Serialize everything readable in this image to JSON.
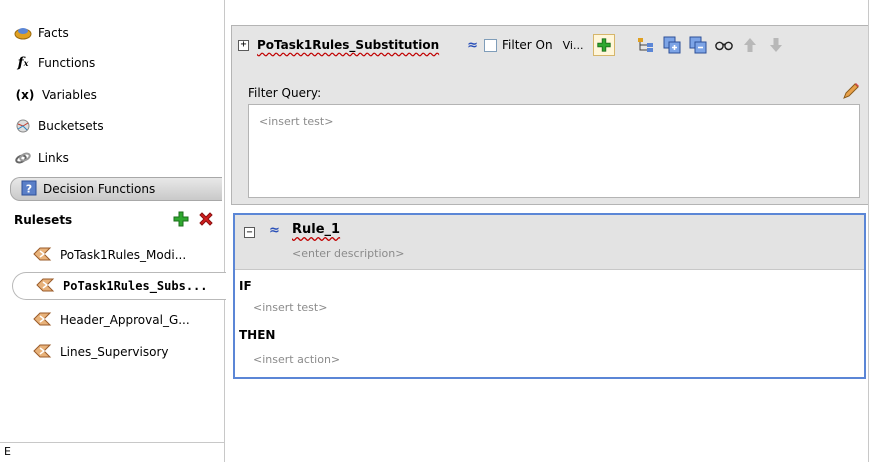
{
  "sidebar": {
    "items": [
      {
        "label": "Facts",
        "icon": "facts-icon"
      },
      {
        "label": "Functions",
        "icon": "functions-icon"
      },
      {
        "label": "Variables",
        "icon": "variables-icon"
      },
      {
        "label": "Bucketsets",
        "icon": "bucketsets-icon"
      },
      {
        "label": "Links",
        "icon": "links-icon"
      }
    ],
    "decision_functions": {
      "label": "Decision Functions",
      "icon": "decision-functions-icon"
    },
    "rulesets": {
      "header": "Rulesets",
      "items": [
        {
          "label": "PoTask1Rules_Modi...",
          "selected": false
        },
        {
          "label": "PoTask1Rules_Subs...",
          "selected": true
        },
        {
          "label": "Header_Approval_G...",
          "selected": false
        },
        {
          "label": "Lines_Supervisory",
          "selected": false
        }
      ]
    },
    "bottom_glyph": "E"
  },
  "ruleset": {
    "expand_glyph": "+",
    "name": "PoTask1Rules_Substitution",
    "collapse_glyph": "≈",
    "filter_on_label": "Filter On",
    "view_label": "Vi...",
    "filter_query_label": "Filter Query:",
    "filter_query_placeholder": "<insert test>"
  },
  "rule": {
    "collapse_glyph": "−",
    "chevron_glyph": "≈",
    "name": "Rule_1",
    "description_placeholder": "<enter description>",
    "if_label": "IF",
    "if_placeholder": "<insert test>",
    "then_label": "THEN",
    "then_placeholder": "<insert action>"
  },
  "colors": {
    "accent_blue": "#5b86d6",
    "add_green": "#2fa82f",
    "delete_red": "#d21f1f"
  }
}
